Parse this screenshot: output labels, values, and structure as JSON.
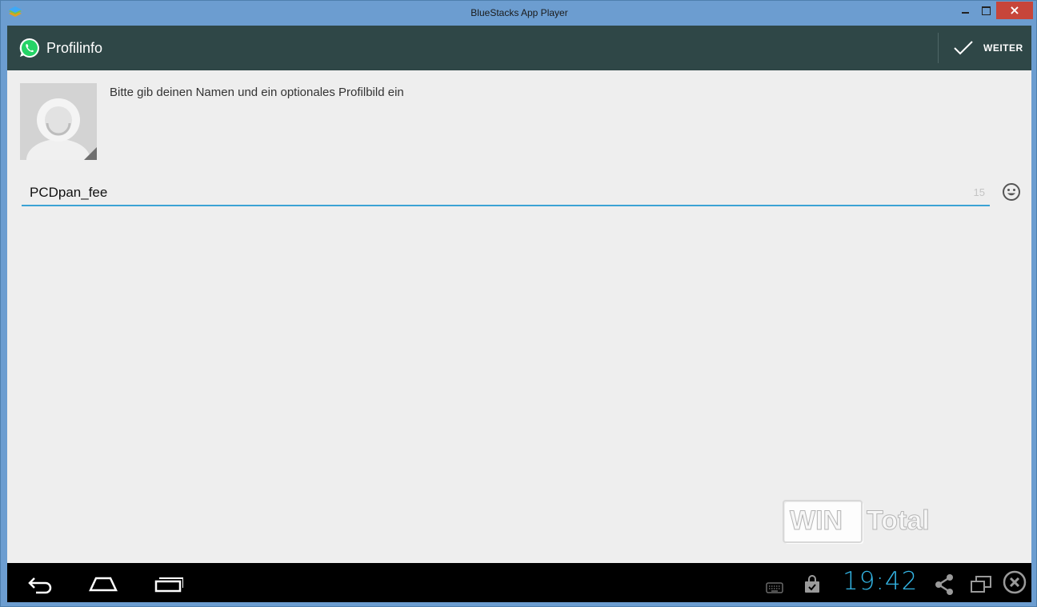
{
  "window": {
    "title": "BlueStacks App Player"
  },
  "actionbar": {
    "title": "Profilinfo",
    "next_label": "WEITER"
  },
  "profile": {
    "instruction": "Bitte gib deinen Namen und ein optionales Profilbild ein",
    "name_value": "PCDpan_fee",
    "remaining_chars": "15"
  },
  "watermark": {
    "text": "WINTotal"
  },
  "navbar": {
    "clock": "19:42"
  },
  "colors": {
    "actionbar_bg": "#2f4747",
    "accent_underline": "#3ba3d5",
    "clock": "#33b5e5",
    "whatsapp_green": "#25d366"
  },
  "icons": {
    "app": "bluestacks-icon",
    "logo": "whatsapp-icon",
    "confirm": "check-icon",
    "emoji": "smiley-icon",
    "back": "back-icon",
    "home": "home-icon",
    "recents": "recent-apps-icon",
    "keyboard": "keyboard-icon",
    "store": "shopping-bag-icon",
    "share": "share-icon",
    "screen": "screen-switch-icon",
    "close": "close-circle-icon"
  }
}
